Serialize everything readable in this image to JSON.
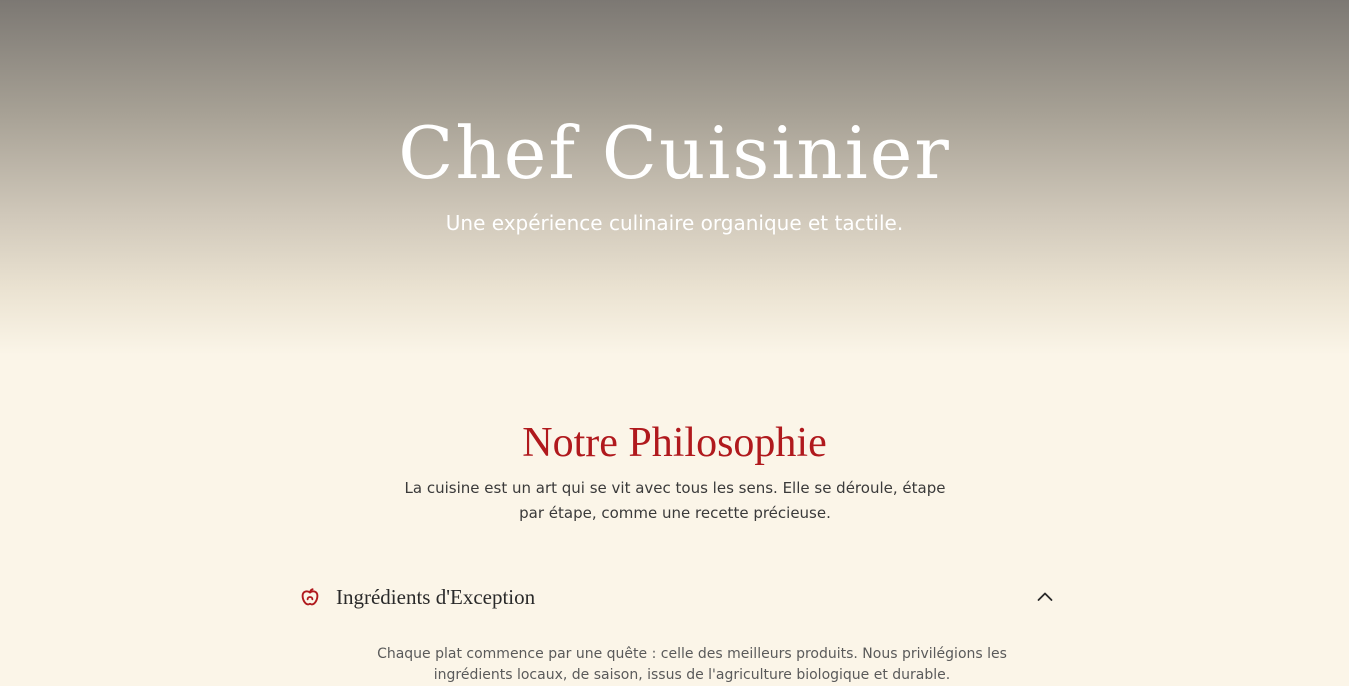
{
  "hero": {
    "title": "Chef Cuisinier",
    "tagline": "Une expérience culinaire organique et tactile."
  },
  "philosophy": {
    "title": "Notre Philosophie",
    "intro": "La cuisine est un art qui se vit avec tous les sens. Elle se déroule, étape par étape, comme une recette précieuse."
  },
  "accordion": {
    "items": [
      {
        "icon": "apple-icon",
        "title": "Ingrédients d'Exception",
        "expanded": true,
        "toggle_icon": "chevron-up-icon",
        "body": "Chaque plat commence par une quête : celle des meilleurs produits. Nous privilégions les ingrédients locaux, de saison, issus de l'agriculture biologique et durable."
      }
    ]
  },
  "colors": {
    "accent": "#b0191d",
    "background": "#fbf5e8",
    "hero_top": "#7c7873",
    "text": "#3a3a3a"
  }
}
